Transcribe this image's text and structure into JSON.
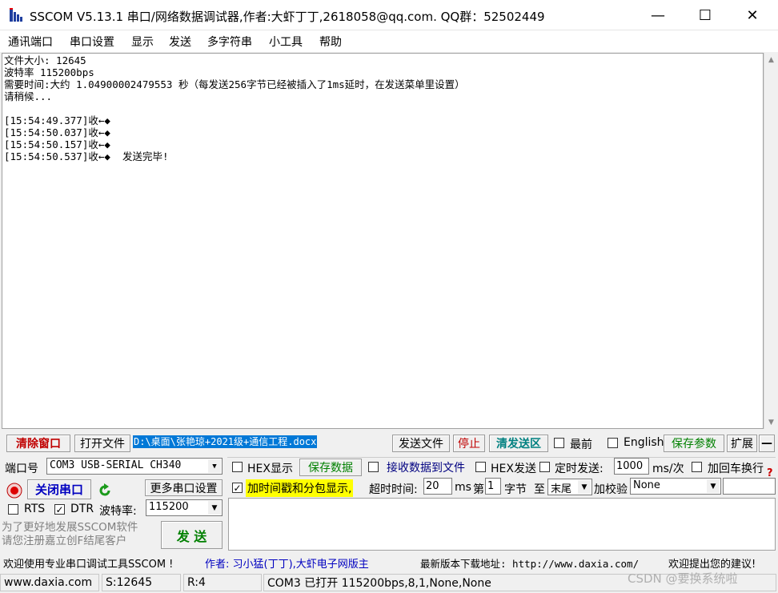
{
  "window": {
    "title": "SSCOM V5.13.1 串口/网络数据调试器,作者:大虾丁丁,2618058@qq.com. QQ群：52502449",
    "minimize": "—",
    "maximize": "☐",
    "close": "✕"
  },
  "menu": [
    "通讯端口",
    "串口设置",
    "显示",
    "发送",
    "多字符串",
    "小工具",
    "帮助"
  ],
  "receive": {
    "lines": "文件大小: 12645\n波特率 115200bps\n需要时间:大约 1.04900002479553 秒（每发送256字节已经被插入了1ms延时，在发送菜单里设置）\n请稍候...\n\n[15:54:49.377]收←◆\n[15:54:50.037]收←◆\n[15:54:50.157]收←◆\n[15:54:50.537]收←◆  发送完毕!"
  },
  "toolbar1": {
    "clear_window": "清除窗口",
    "open_file": "打开文件",
    "file_path": "D:\\桌面\\张艳琼+2021级+通信工程.docx",
    "send_file": "发送文件",
    "stop": "停止",
    "clear_send": "清发送区",
    "topmost": "最前",
    "english": "English",
    "save_params": "保存参数",
    "expand": "扩展",
    "collapse": "—"
  },
  "port": {
    "port_label": "端口号",
    "port_value": "COM3 USB-SERIAL CH340",
    "close_port": "关闭串口",
    "more_settings": "更多串口设置",
    "rts": "RTS",
    "dtr": "DTR",
    "baud_label": "波特率:",
    "baud_value": "115200",
    "promo": "为了更好地发展SSCOM软件\n请您注册嘉立创F结尾客户",
    "send": "发  送"
  },
  "options": {
    "hex_display": "HEX显示",
    "save_data": "保存数据",
    "recv_to_file": "接收数据到文件",
    "hex_send": "HEX发送",
    "timed_send": "定时发送:",
    "timed_interval": "1000",
    "timed_unit": "ms/次",
    "append_crlf": "加回车换行",
    "timestamp": "加时间戳和分包显示,",
    "timeout_label": "超时时间:",
    "timeout_value": "20",
    "timeout_unit": "ms",
    "byte_prefix": "第",
    "byte_index": "1",
    "byte_suffix": "字节",
    "to": "至",
    "end_value": "末尾",
    "checksum_label": "加校验",
    "checksum_value": "None"
  },
  "adbar": {
    "welcome": "欢迎使用专业串口调试工具SSCOM !",
    "author": "作者: 习小猛(丁丁),大虾电子网版主",
    "download": "最新版本下载地址: http://www.daxia.com/",
    "feedback": "欢迎提出您的建议!"
  },
  "status": {
    "site": "www.daxia.com",
    "sent": "S:12645",
    "recv": "R:4",
    "port_state": "COM3 已打开  115200bps,8,1,None,None",
    "watermark": "CSDN @要换系统啦"
  }
}
